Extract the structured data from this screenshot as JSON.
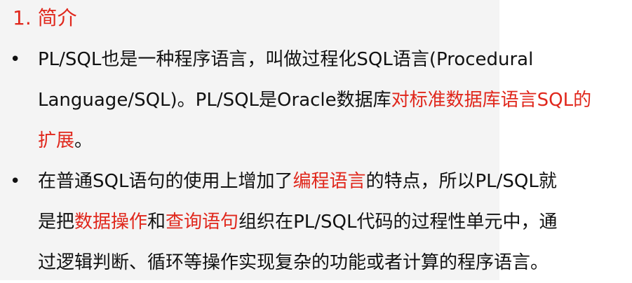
{
  "heading": "1. 简介",
  "bullets": [
    {
      "marker": "•",
      "lines": [
        [
          "PL/SQL也是一种程序语言，叫做过程化SQL语言(Procedural"
        ],
        [
          "Language/SQL)。PL/SQL是Oracle数据库",
          "对标准数据库语言SQL的"
        ],
        [
          "扩展",
          "。"
        ]
      ]
    },
    {
      "marker": "•",
      "lines": [
        [
          "在普通SQL语句的使用上增加了",
          "编程语言",
          "的特点，所以PL/SQL就"
        ],
        [
          "是把",
          "数据操作",
          "和",
          "查询语句",
          "组织在PL/SQL代码的过程性单元中，通"
        ],
        [
          "过逻辑判断、循环等操作实现复杂的功能或者计算的程序语言。"
        ]
      ]
    }
  ],
  "colors": {
    "text": "#111111",
    "highlight": "#e0271c",
    "panel": "#f4f4f4"
  }
}
